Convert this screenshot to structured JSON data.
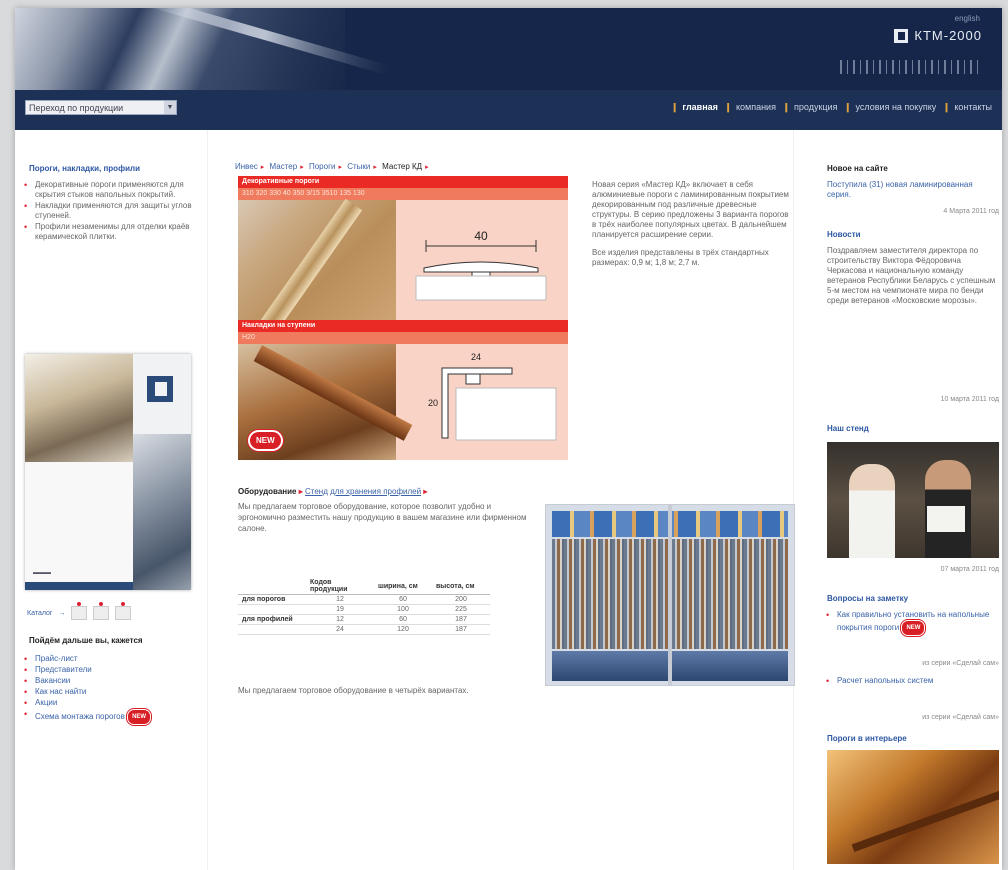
{
  "header": {
    "brand": "КТМ-2000",
    "lang_link": "english"
  },
  "nav": {
    "selector_value": "Переход по продукции",
    "links": [
      "главная",
      "компания",
      "продукция",
      "условия на покупку",
      "контакты"
    ]
  },
  "left": {
    "section_title": "Пороги, накладки, профили",
    "bullets": [
      "Декоративные пороги применяются для скрытия стыков напольных покрытий.",
      "Накладки применяются для защиты углов ступеней.",
      "Профили незаменимы для отделки краёв керамической плитки."
    ],
    "catalog_label": "Каталог",
    "help_title": "Пойдём дальше вы, кажется",
    "help_links": [
      "Прайс-лист",
      "Представители",
      "Вакансии",
      "Как нас найти",
      "Акции",
      "Схема монтажа порогов"
    ],
    "new_badge": "NEW"
  },
  "center": {
    "breadcrumbs": [
      "Инвес",
      "Мастер",
      "Пороги",
      "Стыки",
      "Мастер КД"
    ],
    "promo": {
      "bar1_title": "Декоративные пороги",
      "bar1_sub": "310 320 330 40 350 3/15 3510 135 130",
      "bar2_title": "Накладки на ступени",
      "bar2_sub": "Н20",
      "dim_top": "40",
      "dim_side": "20",
      "dim_top2": "24",
      "new_badge": "NEW"
    },
    "intro_p1": "Новая серия «Мастер КД» включает в себя алюминиевые пороги с ламинированным покрытием декорированным под различные древесные структуры. В серию предложены 3 варианта порогов в трёх наиболее популярных цветах. В дальнейшем планируется расширение серии.",
    "intro_p2": "Все изделия представлены в трёх стандартных размерах: 0,9 м; 1,8 м; 2,7 м.",
    "equipment_label": "Оборудование",
    "equipment_link": "Стенд для хранения профилей",
    "equipment_text": "Мы предлагаем торговое оборудование, которое позволит удобно и эргономично разместить нашу продукцию в вашем магазине или фирменном салоне.",
    "table": {
      "headers": [
        "",
        "Кодов продукции",
        "ширина, см",
        "высота, см"
      ],
      "rows": [
        [
          "для порогов",
          "12",
          "60",
          "200"
        ],
        [
          "",
          "19",
          "100",
          "225"
        ],
        [
          "для профилей",
          "12",
          "60",
          "187"
        ],
        [
          "",
          "24",
          "120",
          "187"
        ]
      ]
    },
    "footnote": "Мы предлагаем торговое оборудование в четырёх вариантах."
  },
  "right": {
    "new_on_site_title": "Новое на сайте",
    "new_on_site_text": "Поступила (31) новая ламинированная серия.",
    "new_on_site_date": "4 Марта 2011 год",
    "news_title": "Новости",
    "news_text": "Поздравляем заместителя директора по строительству Виктора Фёдоровича Черкасова и национальную команду ветеранов Республики Беларусь с успешным 5-м местом на чемпионате мира по бенди среди ветеранов «Московские морозы».",
    "news_date": "10 марта 2011 год",
    "exhibition_title": "Наш стенд",
    "exhibition_date": "07 марта 2011 год",
    "question_title": "Вопросы на заметку",
    "question_links": [
      "Как правильно установить на напольные покрытия пороги",
      "Расчет напольных систем"
    ],
    "question_meta": [
      "из серии «Сделай сам»",
      "из серии «Сделай сам»"
    ],
    "interior_title": "Пороги в интерьере",
    "new_badge": "NEW"
  }
}
